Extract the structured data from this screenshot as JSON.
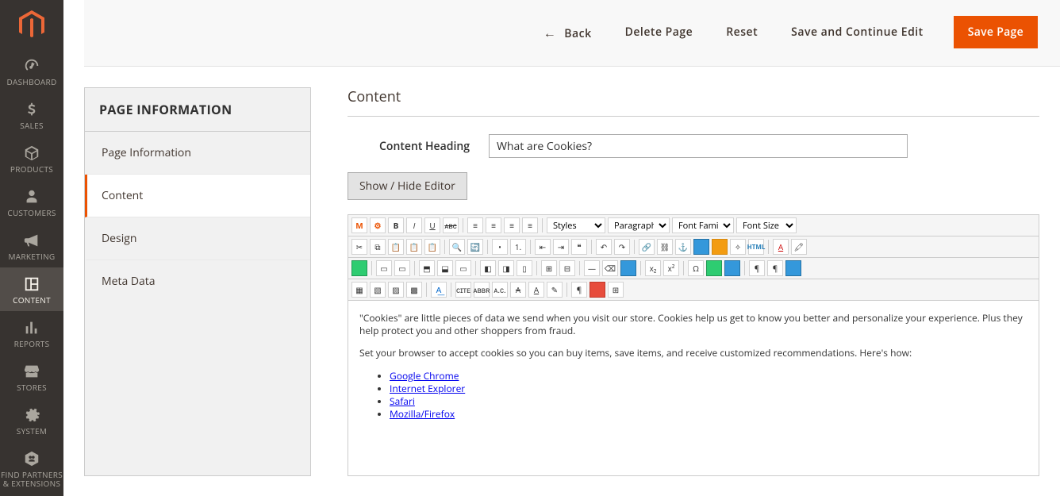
{
  "nav": {
    "items": [
      {
        "name": "dashboard",
        "label": "DASHBOARD"
      },
      {
        "name": "sales",
        "label": "SALES"
      },
      {
        "name": "products",
        "label": "PRODUCTS"
      },
      {
        "name": "customers",
        "label": "CUSTOMERS"
      },
      {
        "name": "marketing",
        "label": "MARKETING"
      },
      {
        "name": "content",
        "label": "CONTENT"
      },
      {
        "name": "reports",
        "label": "REPORTS"
      },
      {
        "name": "stores",
        "label": "STORES"
      },
      {
        "name": "system",
        "label": "SYSTEM"
      },
      {
        "name": "partners",
        "label": "FIND PARTNERS & EXTENSIONS"
      }
    ]
  },
  "header": {
    "back": "Back",
    "delete": "Delete Page",
    "reset": "Reset",
    "save_continue": "Save and Continue Edit",
    "save": "Save Page"
  },
  "side": {
    "title": "PAGE INFORMATION",
    "tabs": [
      {
        "label": "Page Information"
      },
      {
        "label": "Content"
      },
      {
        "label": "Design"
      },
      {
        "label": "Meta Data"
      }
    ]
  },
  "content": {
    "section_title": "Content",
    "heading_label": "Content Heading",
    "heading_value": "What are Cookies?",
    "toggle_editor": "Show / Hide Editor",
    "toolbar_selects": {
      "styles": "Styles",
      "paragraph": "Paragraph",
      "font_family": "Font Family",
      "font_size": "Font Size"
    },
    "body": {
      "p1": "\"Cookies\" are little pieces of data we send when you visit our store. Cookies help us get to know you better and personalize your experience. Plus they help protect you and other shoppers from fraud.",
      "p2": "Set your browser to accept cookies so you can buy items, save items, and receive customized recommendations. Here's how:",
      "links": [
        "Google Chrome",
        "Internet Explorer",
        "Safari",
        "Mozilla/Firefox"
      ]
    }
  }
}
